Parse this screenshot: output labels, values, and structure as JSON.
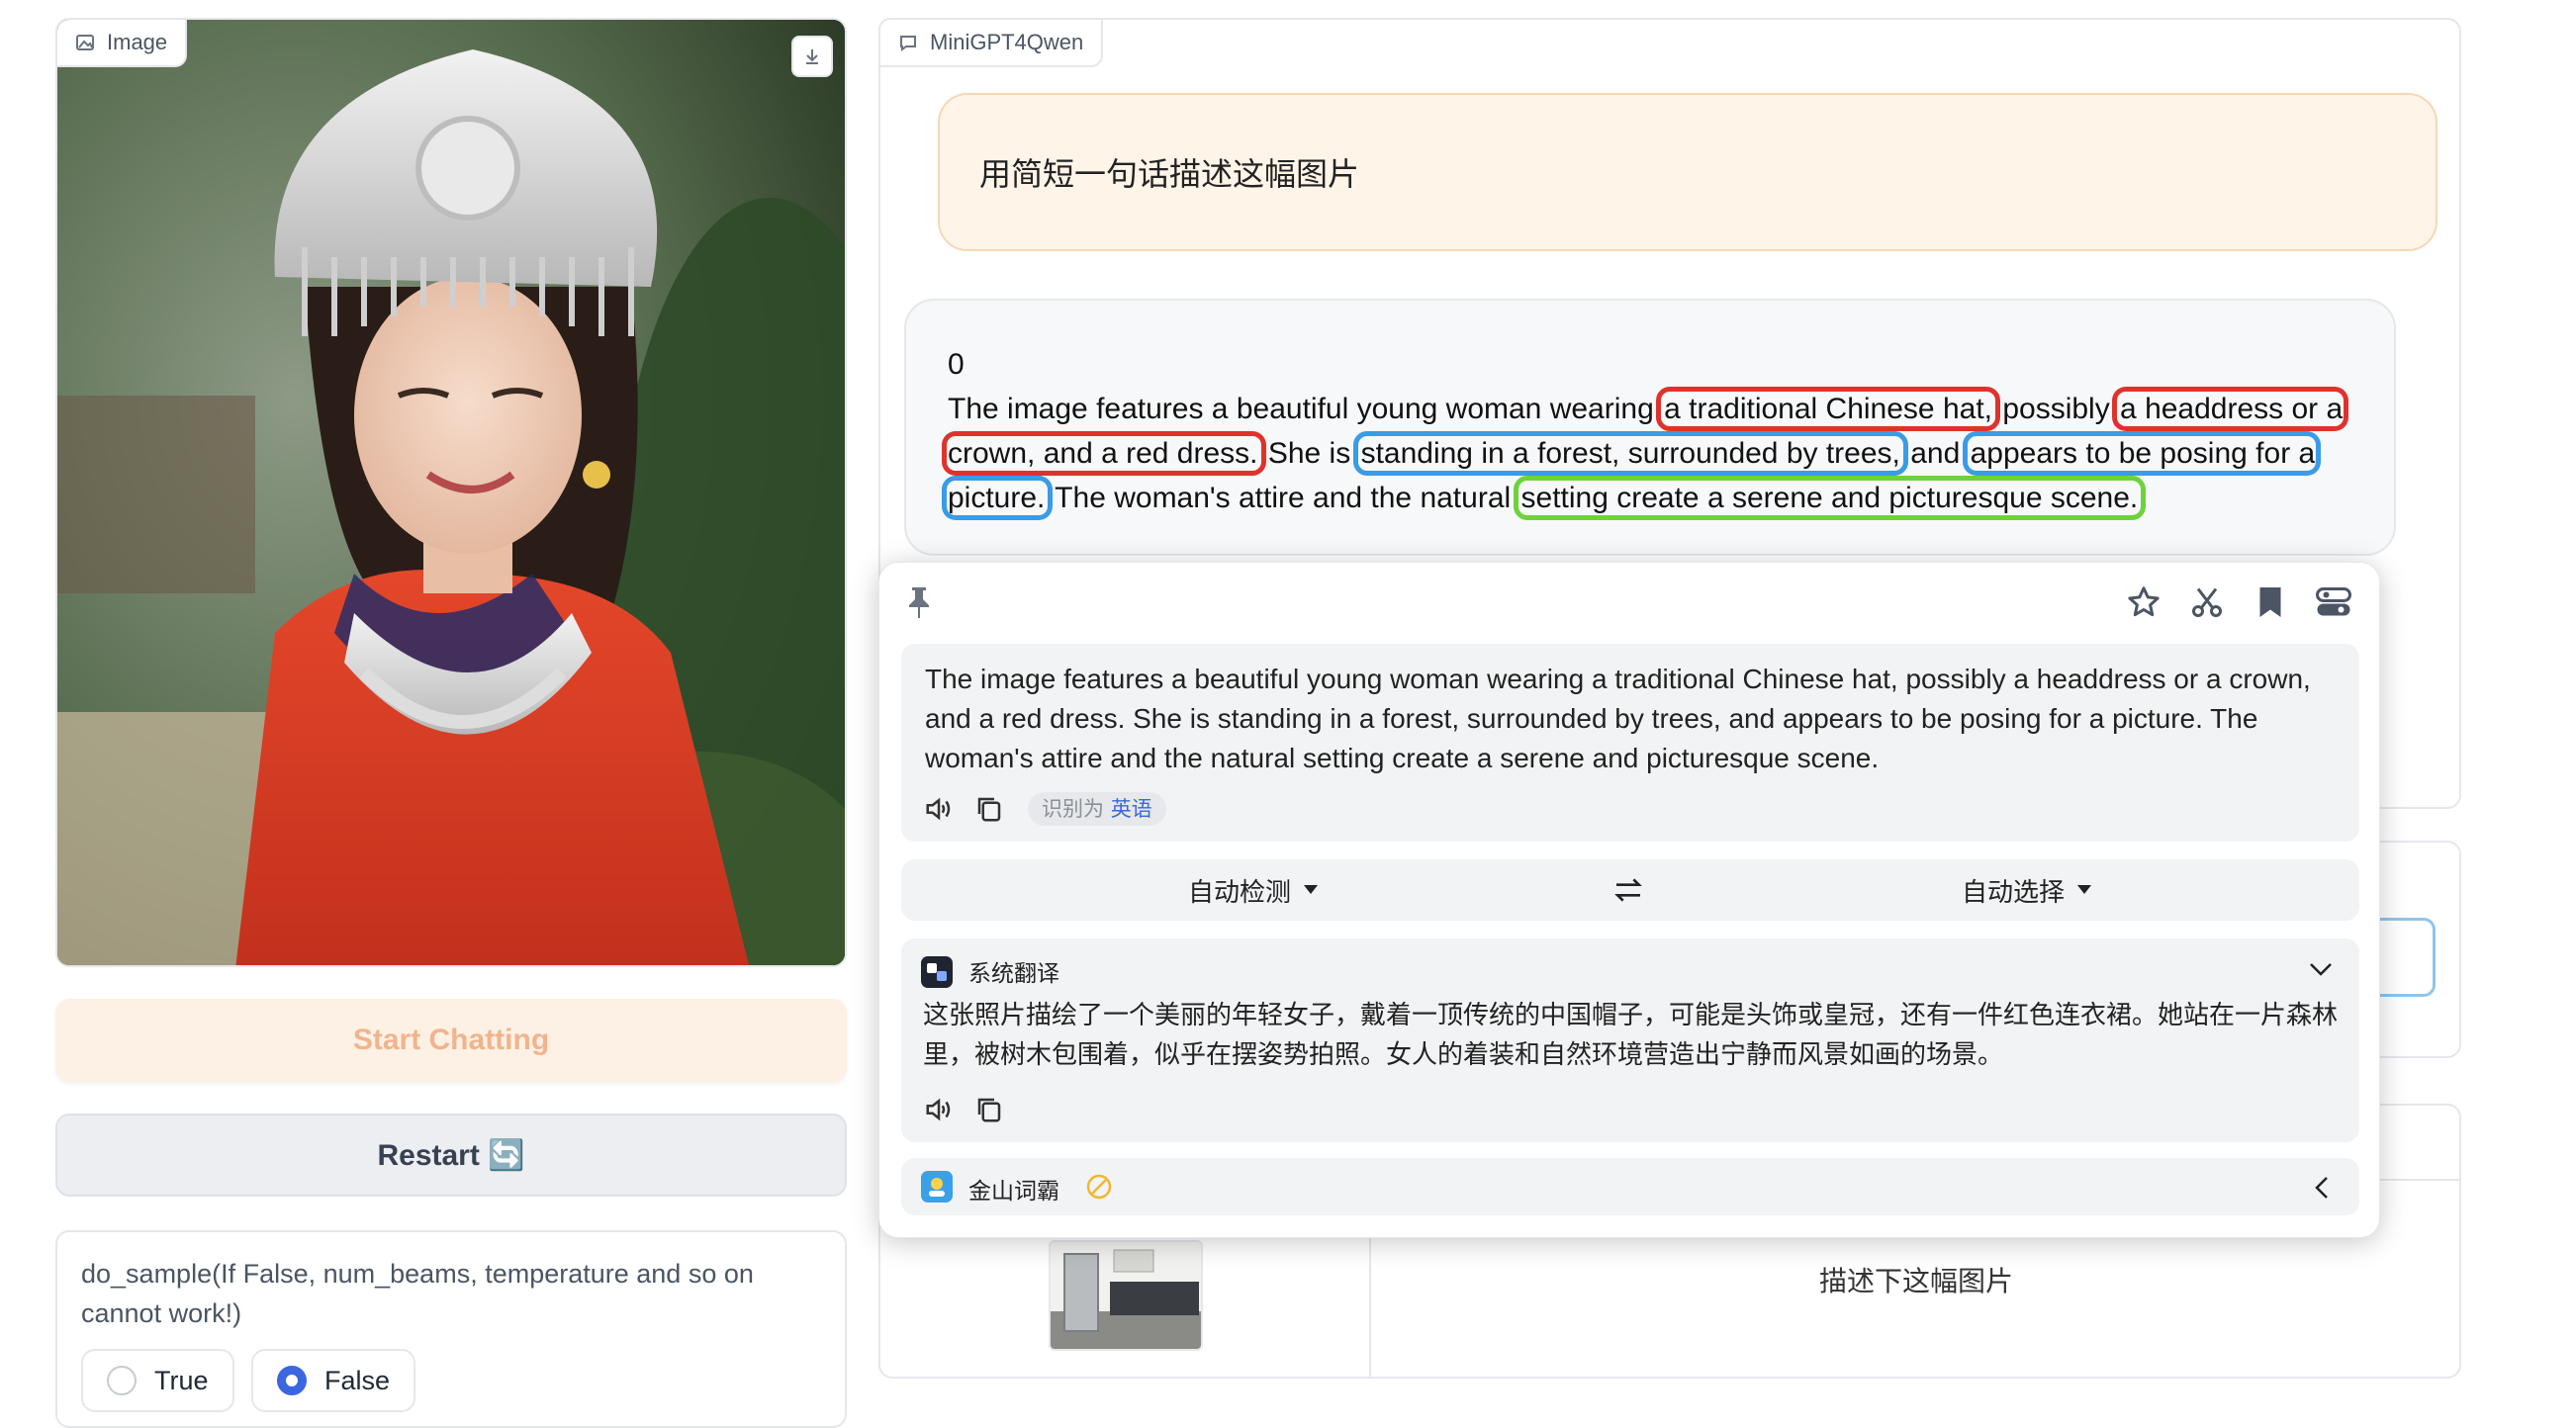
{
  "image_panel": {
    "tab_label": "Image"
  },
  "chat_panel": {
    "tab_label": "MiniGPT4Qwen",
    "user_message": "用简短一句话描述这幅图片",
    "bot_index": "0",
    "bot_segments": [
      "The image features a beautiful young woman wearing ",
      "a traditional Chinese hat,",
      " possibly ",
      "a headdress or a crown, and a red dress.",
      " She is ",
      "standing in a forest, surrounded by trees,",
      " and ",
      "appears to be posing for a picture.",
      " The woman's attire and the natural ",
      "setting create a serene and picturesque scene."
    ]
  },
  "buttons": {
    "start": "Start Chatting",
    "restart": "Restart 🔄"
  },
  "sampling": {
    "label": "do_sample(If False, num_beams, temperature and so on cannot work!)",
    "options": [
      "True",
      "False"
    ],
    "selected": "False"
  },
  "examples": {
    "prompt": "描述下这幅图片"
  },
  "translator": {
    "source_text": "The image features a beautiful young woman wearing a traditional Chinese hat, possibly a headdress or a crown, and a red dress. She is standing in a forest, surrounded by trees, and appears to be posing for a picture. The woman's attire and the natural setting create a serene and picturesque scene.",
    "detected_prefix": "识别为",
    "detected_lang": "英语",
    "source_lang": "自动检测",
    "target_lang": "自动选择",
    "engine_name": "系统翻译",
    "translation": "这张照片描绘了一个美丽的年轻女子，戴着一顶传统的中国帽子，可能是头饰或皇冠，还有一件红色连衣裙。她站在一片森林里，被树木包围着，似乎在摆姿势拍照。女人的着装和自然环境营造出宁静而风景如画的场景。",
    "dict_name": "金山词霸"
  },
  "colors": {
    "accent": "#3b66e0",
    "highlight_red": "#e0322c",
    "highlight_blue": "#3a9be6",
    "highlight_green": "#6dd33b",
    "user_bubble": "#fff4e8"
  }
}
